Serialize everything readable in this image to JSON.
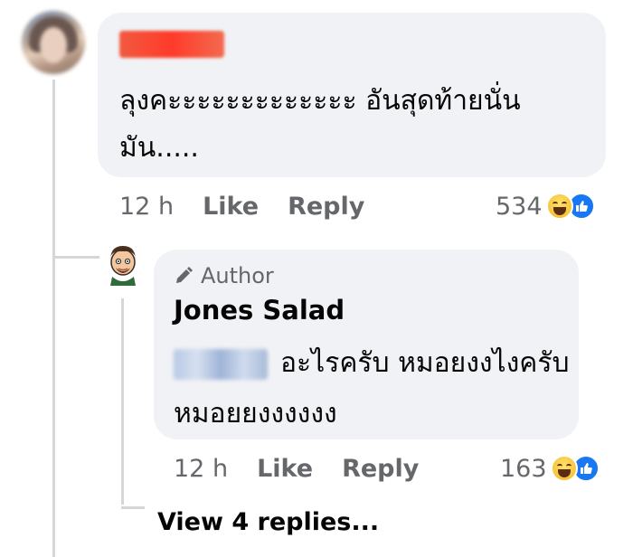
{
  "comment": {
    "text": "ลุงคะะะะะะะะะะะะะ อันสุดท้ายนั่นมัน.....",
    "time": "12 h",
    "like_label": "Like",
    "reply_label": "Reply",
    "reaction_count": "534",
    "reaction_icons": [
      "haha-icon",
      "like-icon"
    ]
  },
  "reply": {
    "badge_label": "Author",
    "author_name": "Jones Salad",
    "text": "อะไรครับ หมอยงงไงครับ หมอยยงงงงงง",
    "time": "12 h",
    "like_label": "Like",
    "reply_label": "Reply",
    "reaction_count": "163",
    "reaction_icons": [
      "haha-icon",
      "like-icon"
    ]
  },
  "thread": {
    "view_replies_label": "View 4 replies..."
  },
  "colors": {
    "bubble": "#f0f2f5",
    "meta_text": "#65676b",
    "like_blue": "#1877f2"
  }
}
